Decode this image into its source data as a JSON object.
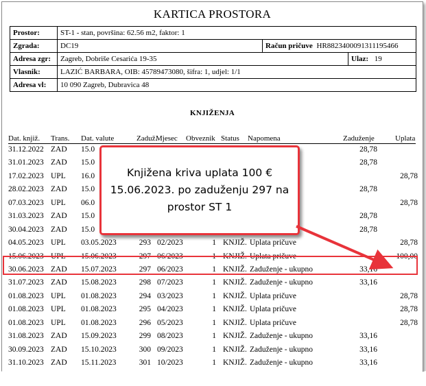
{
  "title": "KARTICA PROSTORA",
  "info": {
    "prostor_label": "Prostor:",
    "prostor_value": "ST-1 - stan,  površina: 62.56 m2,  faktor: 1",
    "zgrada_label": "Zgrada:",
    "zgrada_value": "DC19",
    "racun_label": "Račun pričuve",
    "racun_value": "HR8823400091311195466",
    "adresa_zgr_label": "Adresa zgr:",
    "adresa_zgr_value": "Zagreb, Dobriše Cesarića 19-35",
    "ulaz_label": "Ulaz:",
    "ulaz_value": "19",
    "vlasnik_label": "Vlasnik:",
    "vlasnik_value": "LAZIĆ BARBARA, OIB: 45789473080, šifra: 1, udjel: 1/1",
    "adresa_vl_label": "Adresa vl:",
    "adresa_vl_value": "10 090 Zagreb, Dubravica 48"
  },
  "section_heading": "KNJIŽENJA",
  "columns": {
    "dat_knjiz": "Dat. knjiž.",
    "trans": "Trans.",
    "dat_valute": "Dat. valute",
    "zaduz": "Zaduž.",
    "mjesec": "Mjesec",
    "obveznik": "Obveznik",
    "status": "Status",
    "napomena": "Napomena",
    "zaduzenje": "Zaduženje",
    "uplata": "Uplata"
  },
  "rows": [
    {
      "dk": "31.12.2022",
      "tr": "ZAD",
      "dv": "15.0",
      "z": "",
      "m": "",
      "o": "",
      "s": "",
      "n": "upno",
      "zd": "28,78",
      "up": ""
    },
    {
      "dk": "31.01.2023",
      "tr": "ZAD",
      "dv": "15.0",
      "z": "",
      "m": "",
      "o": "",
      "s": "",
      "n": "upno",
      "zd": "28,78",
      "up": ""
    },
    {
      "dk": "17.02.2023",
      "tr": "UPL",
      "dv": "16.0",
      "z": "",
      "m": "",
      "o": "",
      "s": "",
      "n": "",
      "zd": "",
      "up": "28,78"
    },
    {
      "dk": "28.02.2023",
      "tr": "ZAD",
      "dv": "15.0",
      "z": "",
      "m": "",
      "o": "",
      "s": "",
      "n": "upno",
      "zd": "28,78",
      "up": ""
    },
    {
      "dk": "07.03.2023",
      "tr": "UPL",
      "dv": "06.0",
      "z": "",
      "m": "",
      "o": "",
      "s": "",
      "n": "",
      "zd": "",
      "up": "28,78"
    },
    {
      "dk": "31.03.2023",
      "tr": "ZAD",
      "dv": "15.0",
      "z": "",
      "m": "",
      "o": "",
      "s": "",
      "n": "upno",
      "zd": "28,78",
      "up": ""
    },
    {
      "dk": "30.04.2023",
      "tr": "ZAD",
      "dv": "15.0",
      "z": "",
      "m": "",
      "o": "",
      "s": "",
      "n": "upno",
      "zd": "28,78",
      "up": ""
    },
    {
      "dk": "04.05.2023",
      "tr": "UPL",
      "dv": "03.05.2023",
      "z": "293",
      "m": "02/2023",
      "o": "1",
      "s": "KNJIŽ.",
      "n": "Uplata pričuve",
      "zd": "",
      "up": "28,78"
    },
    {
      "dk": "15.06.2023",
      "tr": "UPL",
      "dv": "15.06.2023",
      "z": "297",
      "m": "06/2023",
      "o": "1",
      "s": "KNJIŽ.",
      "n": "Uplata pričuve",
      "zd": "",
      "up": "100,00"
    },
    {
      "dk": "30.06.2023",
      "tr": "ZAD",
      "dv": "15.07.2023",
      "z": "297",
      "m": "06/2023",
      "o": "1",
      "s": "KNJIŽ.",
      "n": "Zaduženje - ukupno",
      "zd": "33,16",
      "up": ""
    },
    {
      "dk": "31.07.2023",
      "tr": "ZAD",
      "dv": "15.08.2023",
      "z": "298",
      "m": "07/2023",
      "o": "1",
      "s": "KNJIŽ.",
      "n": "Zaduženje - ukupno",
      "zd": "33,16",
      "up": ""
    },
    {
      "dk": "01.08.2023",
      "tr": "UPL",
      "dv": "01.08.2023",
      "z": "294",
      "m": "03/2023",
      "o": "1",
      "s": "KNJIŽ.",
      "n": "Uplata pričuve",
      "zd": "",
      "up": "28,78"
    },
    {
      "dk": "01.08.2023",
      "tr": "UPL",
      "dv": "01.08.2023",
      "z": "295",
      "m": "04/2023",
      "o": "1",
      "s": "KNJIŽ.",
      "n": "Uplata pričuve",
      "zd": "",
      "up": "28,78"
    },
    {
      "dk": "01.08.2023",
      "tr": "UPL",
      "dv": "01.08.2023",
      "z": "296",
      "m": "05/2023",
      "o": "1",
      "s": "KNJIŽ.",
      "n": "Uplata pričuve",
      "zd": "",
      "up": "28,78"
    },
    {
      "dk": "31.08.2023",
      "tr": "ZAD",
      "dv": "15.09.2023",
      "z": "299",
      "m": "08/2023",
      "o": "1",
      "s": "KNJIŽ.",
      "n": "Zaduženje - ukupno",
      "zd": "33,16",
      "up": ""
    },
    {
      "dk": "30.09.2023",
      "tr": "ZAD",
      "dv": "15.10.2023",
      "z": "300",
      "m": "09/2023",
      "o": "1",
      "s": "KNJIŽ.",
      "n": "Zaduženje - ukupno",
      "zd": "33,16",
      "up": ""
    },
    {
      "dk": "31.10.2023",
      "tr": "ZAD",
      "dv": "15.11.2023",
      "z": "301",
      "m": "10/2023",
      "o": "1",
      "s": "KNJIŽ.",
      "n": "Zaduženje - ukupno",
      "zd": "33,16",
      "up": ""
    }
  ],
  "callout_text": "Knjižena kriva uplata 100 € 15.06.2023. po zaduženju 297 na prostor ST 1",
  "annotation_color": "#e8333a"
}
